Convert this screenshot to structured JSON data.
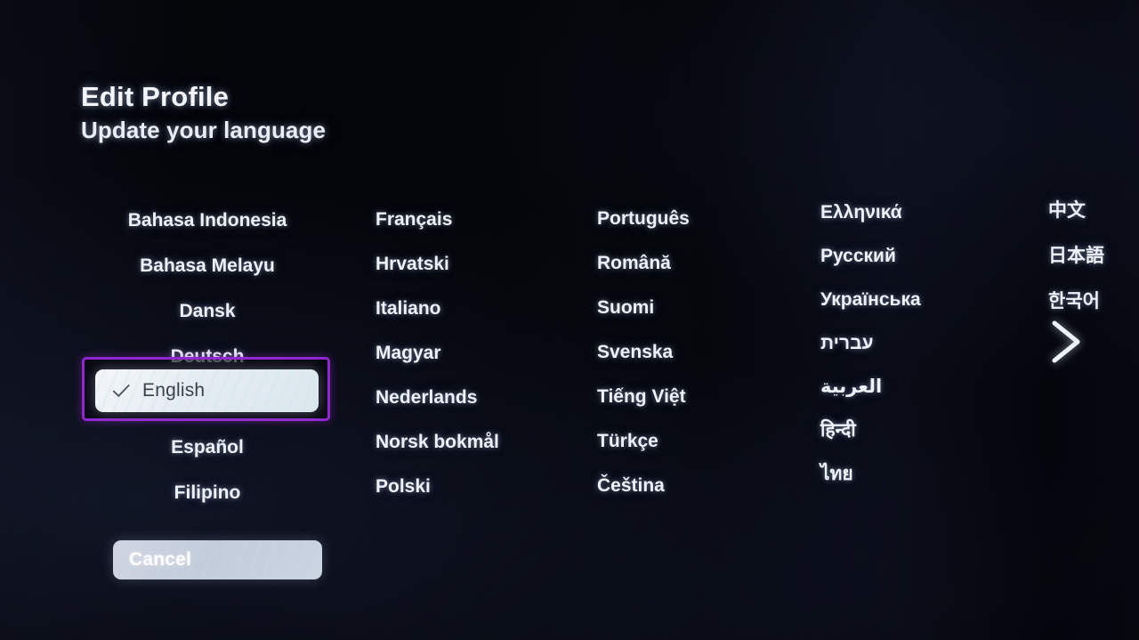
{
  "header": {
    "title": "Edit Profile",
    "subtitle": "Update your language"
  },
  "language_grid": {
    "columns": [
      {
        "id": "column-1",
        "items": [
          "Bahasa Indonesia",
          "Bahasa Melayu",
          "Dansk",
          "Deutsch",
          "English",
          "Español",
          "Filipino"
        ]
      },
      {
        "id": "column-2",
        "items": [
          "Français",
          "Hrvatski",
          "Italiano",
          "Magyar",
          "Nederlands",
          "Norsk bokmål",
          "Polski"
        ]
      },
      {
        "id": "column-3",
        "items": [
          "Português",
          "Română",
          "Suomi",
          "Svenska",
          "Tiếng Việt",
          "Türkçe",
          "Čeština"
        ]
      },
      {
        "id": "column-4",
        "items": [
          "Ελληνικά",
          "Русский",
          "Українська",
          "עברית",
          "العربية",
          "हिन्दी",
          "ไทย"
        ]
      },
      {
        "id": "column-5",
        "items": [
          "中文",
          "日本語",
          "한국어"
        ]
      }
    ]
  },
  "selected": {
    "label": "English",
    "check_icon": "check-icon",
    "focused": true
  },
  "pagination": {
    "next_icon": "chevron-right-icon"
  },
  "actions": {
    "cancel_label": "Cancel"
  },
  "colors": {
    "focus_ring": "#9126cf",
    "selected_pill": "#e7eef3",
    "selected_text": "#3b4149",
    "button_face": "#c7d0de",
    "button_text": "#ffffff",
    "list_text": "#eef1f8",
    "background": "#030409"
  }
}
